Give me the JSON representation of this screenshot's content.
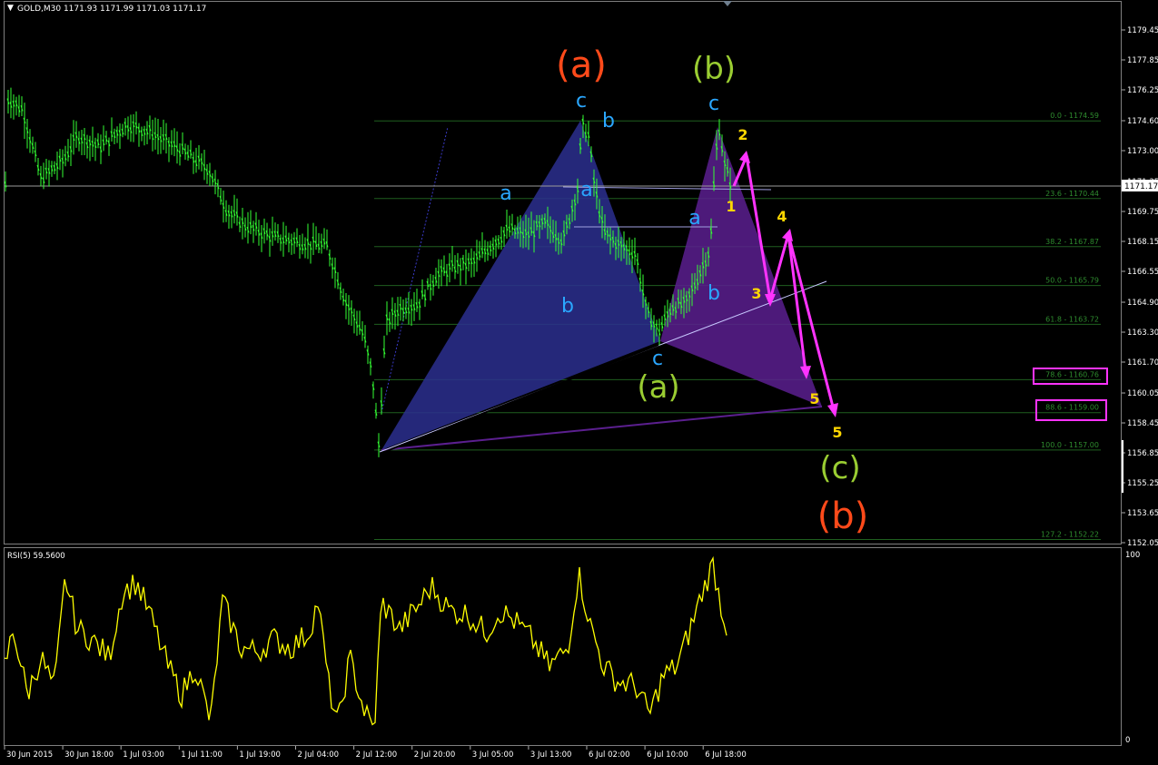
{
  "header": {
    "symbol_line": "GOLD,M30  1171.93 1171.99 1171.03 1171.17",
    "current_price": "1171.17"
  },
  "price_axis": {
    "min": 1152.05,
    "max": 1179.45,
    "ticks": [
      "1179.45",
      "1177.85",
      "1176.25",
      "1174.60",
      "1173.00",
      "1171.35",
      "1169.75",
      "1168.15",
      "1166.55",
      "1164.90",
      "1163.30",
      "1161.70",
      "1160.05",
      "1158.45",
      "1156.85",
      "1155.25",
      "1153.65",
      "1152.05"
    ]
  },
  "fib_levels": [
    {
      "label": "0.0 - 1174.59",
      "price": 1174.59,
      "boxed": false
    },
    {
      "label": "23.6 - 1170.44",
      "price": 1170.44,
      "boxed": false
    },
    {
      "label": "38.2 - 1167.87",
      "price": 1167.87,
      "boxed": false
    },
    {
      "label": "50.0 - 1165.79",
      "price": 1165.79,
      "boxed": false
    },
    {
      "label": "61.8 - 1163.72",
      "price": 1163.72,
      "boxed": false
    },
    {
      "label": "78.6 - 1160.76",
      "price": 1160.76,
      "boxed": true
    },
    {
      "label": "88.6 - 1159.00",
      "price": 1159.0,
      "boxed": true
    },
    {
      "label": "100.0 - 1157.00",
      "price": 1157.0,
      "boxed": false
    },
    {
      "label": "127.2 - 1152.22",
      "price": 1152.22,
      "boxed": false
    }
  ],
  "wave_labels": [
    {
      "text": "(a)",
      "color": "#ff4a1a",
      "size": 40
    },
    {
      "text": "(b)",
      "color": "#9acd32",
      "size": 34
    },
    {
      "text": "(a)",
      "color": "#9acd32",
      "size": 34
    },
    {
      "text": "(c)",
      "color": "#9acd32",
      "size": 34
    },
    {
      "text": "(b)",
      "color": "#ff4a1a",
      "size": 40
    },
    {
      "text": "c",
      "color": "#2aa7ff",
      "size": 22
    },
    {
      "text": "b",
      "color": "#2aa7ff",
      "size": 22
    },
    {
      "text": "a",
      "color": "#2aa7ff",
      "size": 22
    },
    {
      "text": "a",
      "color": "#2aa7ff",
      "size": 22
    },
    {
      "text": "b",
      "color": "#2aa7ff",
      "size": 22
    },
    {
      "text": "c",
      "color": "#2aa7ff",
      "size": 22
    },
    {
      "text": "c",
      "color": "#2aa7ff",
      "size": 22
    },
    {
      "text": "a",
      "color": "#2aa7ff",
      "size": 22
    },
    {
      "text": "b",
      "color": "#2aa7ff",
      "size": 22
    },
    {
      "text": "1",
      "color": "#ffd700",
      "size": 16
    },
    {
      "text": "2",
      "color": "#ffd700",
      "size": 16
    },
    {
      "text": "3",
      "color": "#ffd700",
      "size": 16
    },
    {
      "text": "4",
      "color": "#ffd700",
      "size": 16
    },
    {
      "text": "5",
      "color": "#ffd700",
      "size": 16
    },
    {
      "text": "5",
      "color": "#ffd700",
      "size": 16
    }
  ],
  "rsi": {
    "label": "RSI(5) 59.5600",
    "max_label": "100",
    "min_label": "0",
    "color": "#ffff00"
  },
  "time_axis": [
    "30 Jun 2015",
    "30 Jun 18:00",
    "1 Jul 03:00",
    "1 Jul 11:00",
    "1 Jul 19:00",
    "2 Jul 04:00",
    "2 Jul 12:00",
    "2 Jul 20:00",
    "3 Jul 05:00",
    "3 Jul 13:00",
    "6 Jul 02:00",
    "6 Jul 10:00",
    "6 Jul 18:00"
  ],
  "colors": {
    "candle": "#33ff33",
    "fib_line": "#1f5f1f",
    "fib_text": "#2e8b2e",
    "pattern_blue": "#2b2f8f",
    "pattern_purple": "#5b1f8f",
    "projection": "#ff33ff",
    "highlight_box": "#ff33ff"
  }
}
